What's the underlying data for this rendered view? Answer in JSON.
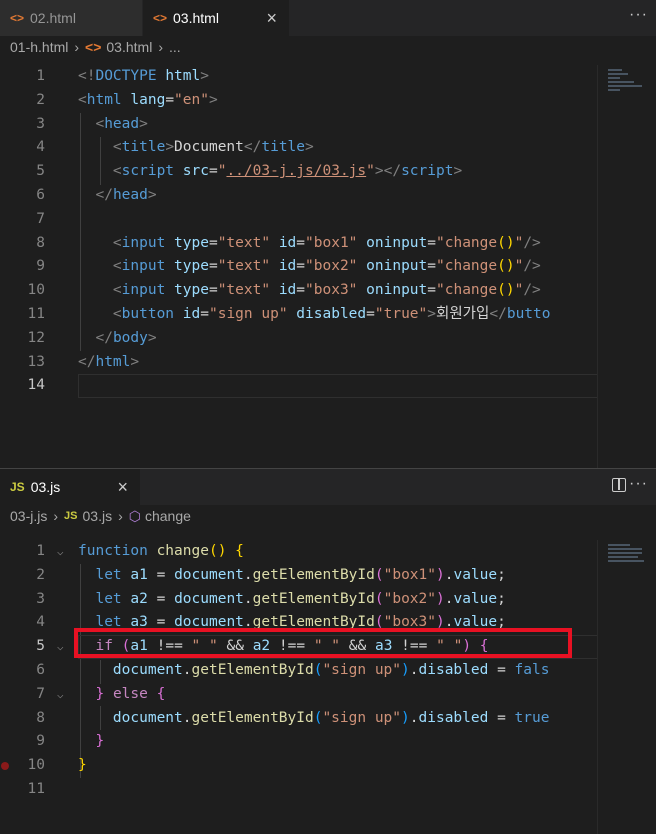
{
  "top": {
    "tabs": [
      {
        "label": "02.html"
      },
      {
        "label": "03.html"
      }
    ],
    "more_label": "···",
    "breadcrumbs": [
      "01-h.html",
      "03.html",
      "..."
    ],
    "lines": [
      {
        "n": "1"
      },
      {
        "n": "2"
      },
      {
        "n": "3"
      },
      {
        "n": "4"
      },
      {
        "n": "5"
      },
      {
        "n": "6"
      },
      {
        "n": "7"
      },
      {
        "n": "8"
      },
      {
        "n": "9"
      },
      {
        "n": "10"
      },
      {
        "n": "11"
      },
      {
        "n": "12"
      },
      {
        "n": "13"
      },
      {
        "n": "14"
      }
    ],
    "code": {
      "doctype": "DOCTYPE",
      "html_kw": "html",
      "html": "html",
      "lang": "lang",
      "lang_val": "\"en\"",
      "head": "head",
      "title": "title",
      "title_text": "Document",
      "script": "script",
      "src": "src",
      "src_val": "../03-j.js/03.js",
      "input": "input",
      "type": "type",
      "text_val": "\"text\"",
      "id": "id",
      "box1": "\"box1\"",
      "box2": "\"box2\"",
      "box3": "\"box3\"",
      "oninput": "oninput",
      "change": "\"change",
      "paren": "()",
      "end_q": "\"",
      "button": "button",
      "signup": "\"sign up\"",
      "disabled": "disabled",
      "true_val": "\"true\"",
      "btn_text": "회원가입",
      "btn_close": "butto",
      "body": "body"
    }
  },
  "bottom": {
    "tab": {
      "label": "03.js"
    },
    "breadcrumbs": [
      "03-j.js",
      "03.js",
      "change"
    ],
    "lines": [
      {
        "n": "1"
      },
      {
        "n": "2"
      },
      {
        "n": "3"
      },
      {
        "n": "4"
      },
      {
        "n": "5"
      },
      {
        "n": "6"
      },
      {
        "n": "7"
      },
      {
        "n": "8"
      },
      {
        "n": "9"
      },
      {
        "n": "10"
      },
      {
        "n": "11"
      }
    ],
    "code": {
      "function": "function",
      "fn_name": "change",
      "let": "let",
      "a1": "a1",
      "a2": "a2",
      "a3": "a3",
      "document": "document",
      "getById": "getElementById",
      "box1": "\"box1\"",
      "box2": "\"box2\"",
      "box3": "\"box3\"",
      "value": "value",
      "if": "if",
      "neq": "!==",
      "space_str": "\" \"",
      "and": "&&",
      "signup": "\"sign up\"",
      "disabled": "disabled",
      "false_partial": "fals",
      "true": "true",
      "else": "else"
    }
  }
}
